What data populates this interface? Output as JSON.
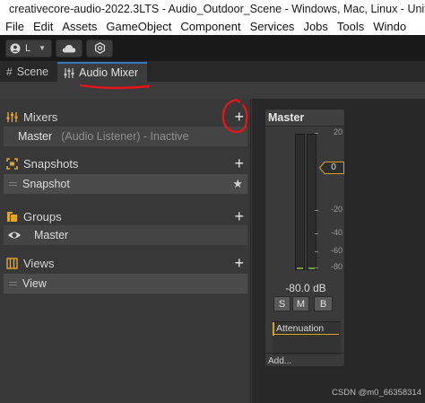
{
  "window": {
    "title": "creativecore-audio-2022.3LTS - Audio_Outdoor_Scene - Windows, Mac, Linux - Unity 2"
  },
  "menu": [
    "File",
    "Edit",
    "Assets",
    "GameObject",
    "Component",
    "Services",
    "Jobs",
    "Tools",
    "Windo"
  ],
  "toolbar": {
    "account_letter": "L"
  },
  "tabs": [
    {
      "label": "Scene",
      "icon": "grid-icon",
      "active": false
    },
    {
      "label": "Audio Mixer",
      "icon": "mixer-sliders-icon",
      "active": true
    }
  ],
  "sections": {
    "mixers": {
      "title": "Mixers",
      "items": [
        {
          "name": "Master",
          "status": "(Audio Listener) - Inactive"
        }
      ]
    },
    "snapshots": {
      "title": "Snapshots",
      "items": [
        {
          "name": "Snapshot"
        }
      ]
    },
    "groups": {
      "title": "Groups",
      "items": [
        {
          "name": "Master"
        }
      ]
    },
    "views": {
      "title": "Views",
      "items": [
        {
          "name": "View"
        }
      ]
    }
  },
  "strip": {
    "title": "Master",
    "scale": [
      "20",
      "0",
      "-20",
      "-40",
      "-60",
      "-80"
    ],
    "fader_value": "0",
    "db": "-80.0 dB",
    "buttons": {
      "solo": "S",
      "mute": "M",
      "bypass": "B"
    },
    "effect": "Attenuation",
    "add": "Add..."
  },
  "watermark": "CSDN @m0_66358314",
  "colors": {
    "accent_yellow": "#d9a318",
    "annotation_red": "#e8131b",
    "meter_green": "#6aa33b",
    "tab_highlight": "#3a79bb"
  }
}
